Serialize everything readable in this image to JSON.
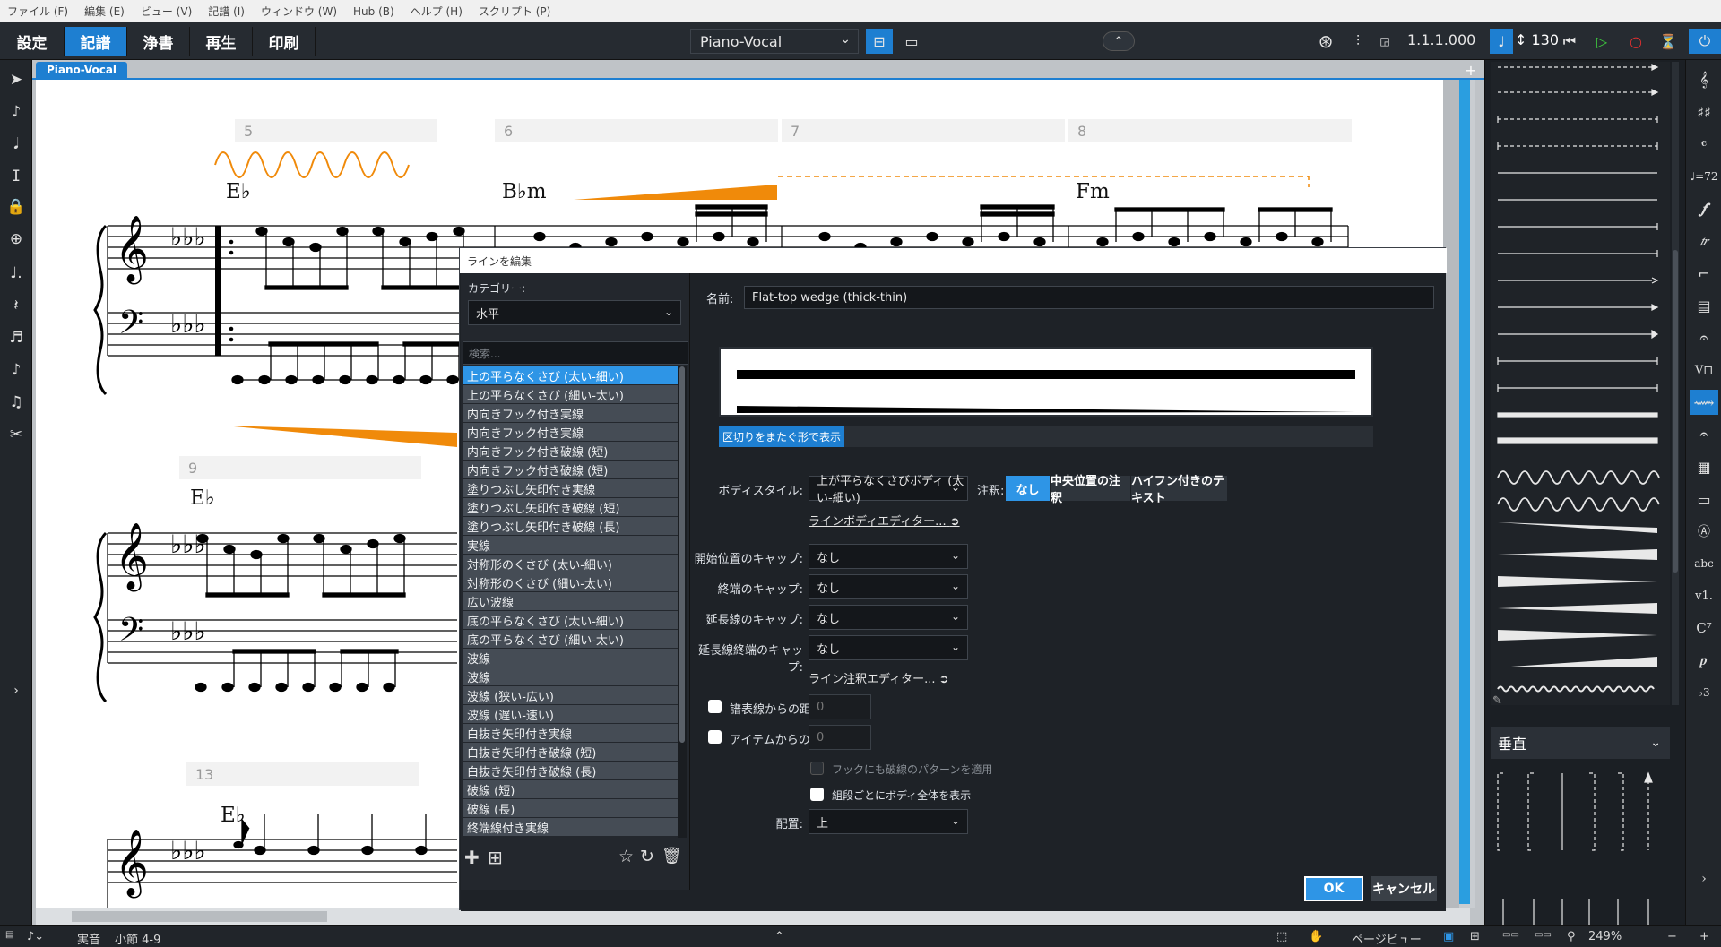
{
  "menu": [
    "ファイル (F)",
    "編集 (E)",
    "ビュー (V)",
    "記譜 (I)",
    "ウィンドウ (W)",
    "Hub (B)",
    "ヘルプ (H)",
    "スクリプト (P)"
  ],
  "modes": [
    "設定",
    "記譜",
    "浄書",
    "再生",
    "印刷"
  ],
  "active_mode": "記譜",
  "layout_select": "Piano-Vocal",
  "transport": {
    "counter": "1.1.1.000",
    "tempo": "130"
  },
  "doc_tab": "Piano-Vocal",
  "score": {
    "bar_numbers": [
      "5",
      "6",
      "7",
      "8",
      "9",
      "13"
    ],
    "chords": [
      "E♭",
      "B♭m",
      "Fm",
      "E♭",
      "E♭"
    ]
  },
  "dialog": {
    "title": "ラインを編集",
    "category_label": "カテゴリー:",
    "category_value": "水平",
    "search_placeholder": "検索...",
    "items": [
      "上の平らなくさび (太い-細い)",
      "上の平らなくさび (細い-太い)",
      "内向きフック付き実線",
      "内向きフック付き実線",
      "内向きフック付き破線 (短)",
      "内向きフック付き破線 (短)",
      "塗りつぶし矢印付き実線",
      "塗りつぶし矢印付き破線 (短)",
      "塗りつぶし矢印付き破線 (長)",
      "実線",
      "対称形のくさび (太い-細い)",
      "対称形のくさび (細い-太い)",
      "広い波線",
      "底の平らなくさび (太い-細い)",
      "底の平らなくさび (細い-太い)",
      "波線",
      "波線",
      "波線 (狭い-広い)",
      "波線 (遅い-速い)",
      "白抜き矢印付き実線",
      "白抜き矢印付き破線 (短)",
      "白抜き矢印付き破線 (長)",
      "破線 (短)",
      "破線 (長)",
      "終端線付き実線"
    ],
    "selected_index": 0,
    "name_label": "名前:",
    "name_value": "Flat-top wedge (thick-thin)",
    "preview_button": "区切りをまたぐ形で表示",
    "body_style_label": "ボディスタイル:",
    "body_style_value": "上が平らなくさびボディ (太い-細い)",
    "annotation_label": "注釈:",
    "annotation_options": [
      "なし",
      "中央位置の注釈",
      "ハイフン付きのテキスト"
    ],
    "annotation_selected": "なし",
    "body_editor_link": "ラインボディエディター...",
    "start_cap_label": "開始位置のキャップ:",
    "start_cap_value": "なし",
    "end_cap_label": "終端のキャップ:",
    "end_cap_value": "なし",
    "cont_cap_label": "延長線のキャップ:",
    "cont_cap_value": "なし",
    "cont_end_cap_label": "延長線終端のキャップ:",
    "cont_end_cap_value": "なし",
    "annotation_editor_link": "ライン注釈エディター...",
    "staff_distance_label": "譜表線からの距離:",
    "staff_distance_value": "0",
    "item_distance_label": "アイテムからの距離:",
    "item_distance_value": "0",
    "hook_dash_label": "フックにも破線のパターンを適用",
    "full_body_label": "組段ごとにボディ全体を表示",
    "placement_label": "配置:",
    "placement_value": "上",
    "ok": "OK",
    "cancel": "キャンセル"
  },
  "right_panel": {
    "section": "垂直"
  },
  "right_toolbar_text": [
    "abc",
    "v1.",
    "C⁷"
  ],
  "status": {
    "mode": "実音",
    "measures": "小節 4-9",
    "view": "ページビュー",
    "zoom": "249%"
  },
  "colors": {
    "accent": "#1e7fd1",
    "selection": "#2e95e6",
    "orange": "#f08a0a"
  }
}
